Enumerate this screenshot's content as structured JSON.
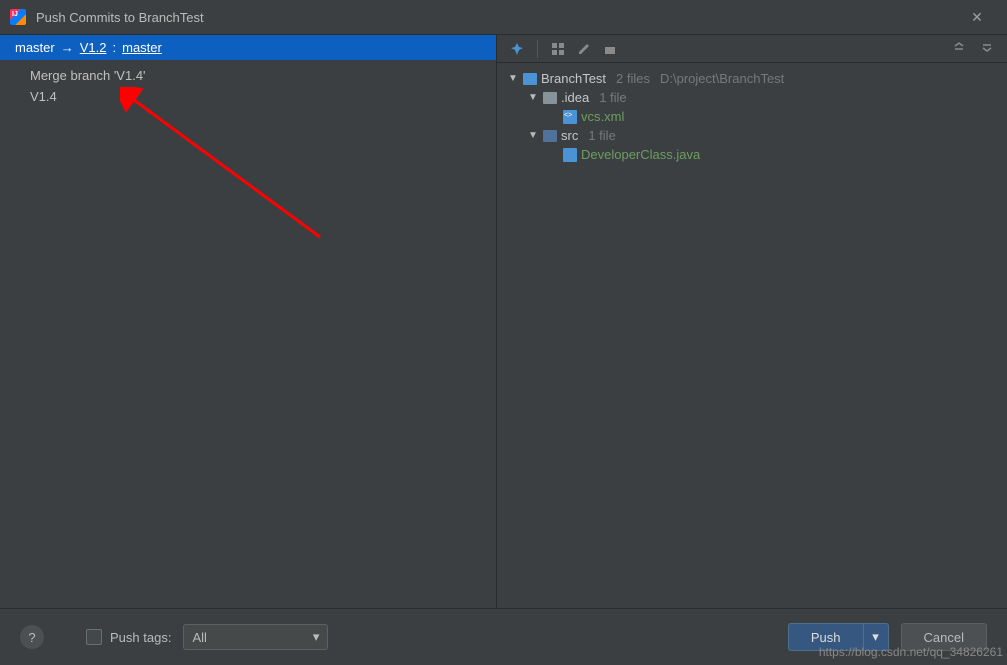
{
  "titlebar": {
    "title": "Push Commits to BranchTest"
  },
  "branchHeader": {
    "local": "master",
    "remote": "V1.2",
    "remoteBranch": "master"
  },
  "commits": [
    {
      "label": "Merge branch 'V1.4'"
    },
    {
      "label": "V1.4"
    }
  ],
  "tree": {
    "root": {
      "name": "BranchTest",
      "info": "2 files",
      "path": "D:\\project\\BranchTest"
    },
    "children": [
      {
        "name": ".idea",
        "info": "1 file",
        "files": [
          {
            "name": "vcs.xml",
            "type": "xml"
          }
        ]
      },
      {
        "name": "src",
        "info": "1 file",
        "files": [
          {
            "name": "DeveloperClass.java",
            "type": "java"
          }
        ]
      }
    ]
  },
  "footer": {
    "pushTagsLabel": "Push tags:",
    "pushTagsValue": "All",
    "pushLabel": "Push",
    "cancelLabel": "Cancel"
  },
  "watermark": "https://blog.csdn.net/qq_34826261",
  "icons": {
    "close": "✕",
    "chevronDown": "▾",
    "triangleDown": "▼",
    "help": "?"
  }
}
